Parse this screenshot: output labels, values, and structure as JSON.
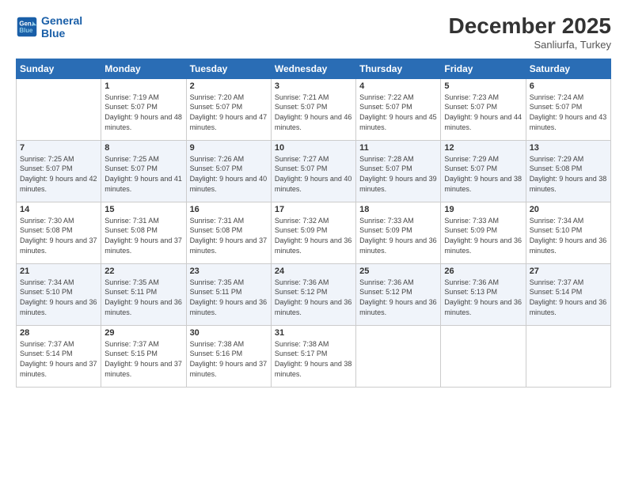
{
  "logo": {
    "line1": "General",
    "line2": "Blue"
  },
  "header": {
    "month": "December 2025",
    "location": "Sanliurfa, Turkey"
  },
  "weekdays": [
    "Sunday",
    "Monday",
    "Tuesday",
    "Wednesday",
    "Thursday",
    "Friday",
    "Saturday"
  ],
  "weeks": [
    [
      {
        "day": "",
        "sunrise": "",
        "sunset": "",
        "daylight": ""
      },
      {
        "day": "1",
        "sunrise": "Sunrise: 7:19 AM",
        "sunset": "Sunset: 5:07 PM",
        "daylight": "Daylight: 9 hours and 48 minutes."
      },
      {
        "day": "2",
        "sunrise": "Sunrise: 7:20 AM",
        "sunset": "Sunset: 5:07 PM",
        "daylight": "Daylight: 9 hours and 47 minutes."
      },
      {
        "day": "3",
        "sunrise": "Sunrise: 7:21 AM",
        "sunset": "Sunset: 5:07 PM",
        "daylight": "Daylight: 9 hours and 46 minutes."
      },
      {
        "day": "4",
        "sunrise": "Sunrise: 7:22 AM",
        "sunset": "Sunset: 5:07 PM",
        "daylight": "Daylight: 9 hours and 45 minutes."
      },
      {
        "day": "5",
        "sunrise": "Sunrise: 7:23 AM",
        "sunset": "Sunset: 5:07 PM",
        "daylight": "Daylight: 9 hours and 44 minutes."
      },
      {
        "day": "6",
        "sunrise": "Sunrise: 7:24 AM",
        "sunset": "Sunset: 5:07 PM",
        "daylight": "Daylight: 9 hours and 43 minutes."
      }
    ],
    [
      {
        "day": "7",
        "sunrise": "Sunrise: 7:25 AM",
        "sunset": "Sunset: 5:07 PM",
        "daylight": "Daylight: 9 hours and 42 minutes."
      },
      {
        "day": "8",
        "sunrise": "Sunrise: 7:25 AM",
        "sunset": "Sunset: 5:07 PM",
        "daylight": "Daylight: 9 hours and 41 minutes."
      },
      {
        "day": "9",
        "sunrise": "Sunrise: 7:26 AM",
        "sunset": "Sunset: 5:07 PM",
        "daylight": "Daylight: 9 hours and 40 minutes."
      },
      {
        "day": "10",
        "sunrise": "Sunrise: 7:27 AM",
        "sunset": "Sunset: 5:07 PM",
        "daylight": "Daylight: 9 hours and 40 minutes."
      },
      {
        "day": "11",
        "sunrise": "Sunrise: 7:28 AM",
        "sunset": "Sunset: 5:07 PM",
        "daylight": "Daylight: 9 hours and 39 minutes."
      },
      {
        "day": "12",
        "sunrise": "Sunrise: 7:29 AM",
        "sunset": "Sunset: 5:07 PM",
        "daylight": "Daylight: 9 hours and 38 minutes."
      },
      {
        "day": "13",
        "sunrise": "Sunrise: 7:29 AM",
        "sunset": "Sunset: 5:08 PM",
        "daylight": "Daylight: 9 hours and 38 minutes."
      }
    ],
    [
      {
        "day": "14",
        "sunrise": "Sunrise: 7:30 AM",
        "sunset": "Sunset: 5:08 PM",
        "daylight": "Daylight: 9 hours and 37 minutes."
      },
      {
        "day": "15",
        "sunrise": "Sunrise: 7:31 AM",
        "sunset": "Sunset: 5:08 PM",
        "daylight": "Daylight: 9 hours and 37 minutes."
      },
      {
        "day": "16",
        "sunrise": "Sunrise: 7:31 AM",
        "sunset": "Sunset: 5:08 PM",
        "daylight": "Daylight: 9 hours and 37 minutes."
      },
      {
        "day": "17",
        "sunrise": "Sunrise: 7:32 AM",
        "sunset": "Sunset: 5:09 PM",
        "daylight": "Daylight: 9 hours and 36 minutes."
      },
      {
        "day": "18",
        "sunrise": "Sunrise: 7:33 AM",
        "sunset": "Sunset: 5:09 PM",
        "daylight": "Daylight: 9 hours and 36 minutes."
      },
      {
        "day": "19",
        "sunrise": "Sunrise: 7:33 AM",
        "sunset": "Sunset: 5:09 PM",
        "daylight": "Daylight: 9 hours and 36 minutes."
      },
      {
        "day": "20",
        "sunrise": "Sunrise: 7:34 AM",
        "sunset": "Sunset: 5:10 PM",
        "daylight": "Daylight: 9 hours and 36 minutes."
      }
    ],
    [
      {
        "day": "21",
        "sunrise": "Sunrise: 7:34 AM",
        "sunset": "Sunset: 5:10 PM",
        "daylight": "Daylight: 9 hours and 36 minutes."
      },
      {
        "day": "22",
        "sunrise": "Sunrise: 7:35 AM",
        "sunset": "Sunset: 5:11 PM",
        "daylight": "Daylight: 9 hours and 36 minutes."
      },
      {
        "day": "23",
        "sunrise": "Sunrise: 7:35 AM",
        "sunset": "Sunset: 5:11 PM",
        "daylight": "Daylight: 9 hours and 36 minutes."
      },
      {
        "day": "24",
        "sunrise": "Sunrise: 7:36 AM",
        "sunset": "Sunset: 5:12 PM",
        "daylight": "Daylight: 9 hours and 36 minutes."
      },
      {
        "day": "25",
        "sunrise": "Sunrise: 7:36 AM",
        "sunset": "Sunset: 5:12 PM",
        "daylight": "Daylight: 9 hours and 36 minutes."
      },
      {
        "day": "26",
        "sunrise": "Sunrise: 7:36 AM",
        "sunset": "Sunset: 5:13 PM",
        "daylight": "Daylight: 9 hours and 36 minutes."
      },
      {
        "day": "27",
        "sunrise": "Sunrise: 7:37 AM",
        "sunset": "Sunset: 5:14 PM",
        "daylight": "Daylight: 9 hours and 36 minutes."
      }
    ],
    [
      {
        "day": "28",
        "sunrise": "Sunrise: 7:37 AM",
        "sunset": "Sunset: 5:14 PM",
        "daylight": "Daylight: 9 hours and 37 minutes."
      },
      {
        "day": "29",
        "sunrise": "Sunrise: 7:37 AM",
        "sunset": "Sunset: 5:15 PM",
        "daylight": "Daylight: 9 hours and 37 minutes."
      },
      {
        "day": "30",
        "sunrise": "Sunrise: 7:38 AM",
        "sunset": "Sunset: 5:16 PM",
        "daylight": "Daylight: 9 hours and 37 minutes."
      },
      {
        "day": "31",
        "sunrise": "Sunrise: 7:38 AM",
        "sunset": "Sunset: 5:17 PM",
        "daylight": "Daylight: 9 hours and 38 minutes."
      },
      {
        "day": "",
        "sunrise": "",
        "sunset": "",
        "daylight": ""
      },
      {
        "day": "",
        "sunrise": "",
        "sunset": "",
        "daylight": ""
      },
      {
        "day": "",
        "sunrise": "",
        "sunset": "",
        "daylight": ""
      }
    ]
  ]
}
